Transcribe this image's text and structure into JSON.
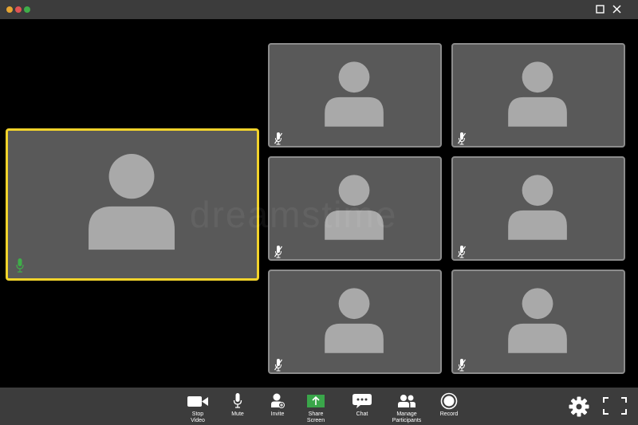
{
  "colors": {
    "titlebar": "#3c3c3c",
    "toolbar": "#3c3c3c",
    "tile": "#595959",
    "tile_border": "#8c8c8c",
    "active_border": "#f2d32b",
    "avatar": "#a9a9a9",
    "mic_active": "#3fae49",
    "share_green": "#3aa64a"
  },
  "window_controls": [
    "traffic-light-close",
    "traffic-light-minimize",
    "traffic-light-zoom",
    "maximize-icon",
    "close-icon"
  ],
  "watermark": "dreamstime",
  "participants": [
    {
      "id": "speaker",
      "active": true,
      "mic": "on"
    },
    {
      "id": "p1",
      "active": false,
      "mic": "muted"
    },
    {
      "id": "p2",
      "active": false,
      "mic": "muted"
    },
    {
      "id": "p3",
      "active": false,
      "mic": "muted"
    },
    {
      "id": "p4",
      "active": false,
      "mic": "muted"
    },
    {
      "id": "p5",
      "active": false,
      "mic": "muted"
    },
    {
      "id": "p6",
      "active": false,
      "mic": "muted"
    }
  ],
  "toolbar": {
    "stop_video": "Stop\nVideo",
    "mute": "Mute",
    "invite": "Invite",
    "share_screen": "Share\nScreen",
    "chat": "Chat",
    "manage_participants": "Manage\nParticipants",
    "record": "Record",
    "settings_icon": "gear-icon",
    "fullscreen_icon": "fullscreen-icon"
  }
}
